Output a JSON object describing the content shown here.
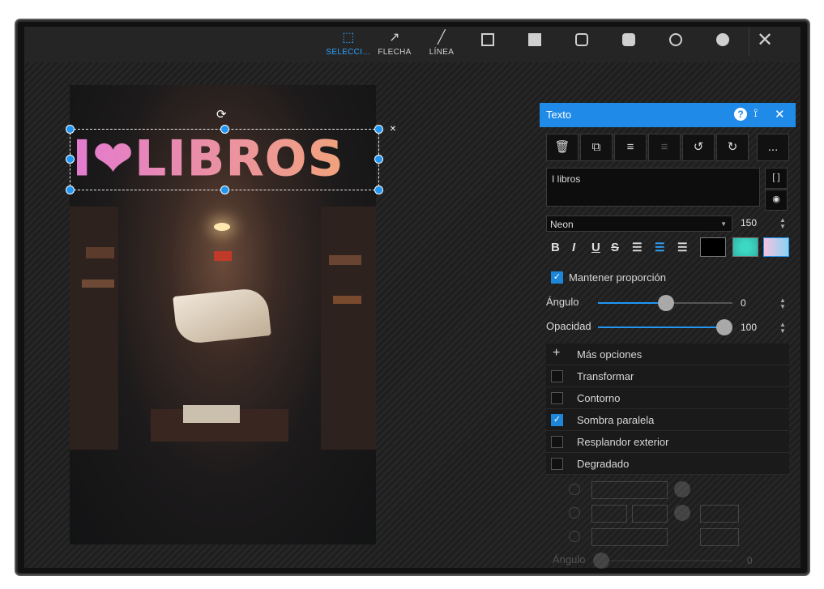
{
  "toolbar": {
    "select_label": "SELECCI…",
    "arrow_label": "FLECHA",
    "line_label": "LÍNEA"
  },
  "canvas": {
    "neon_text": "I❤LIBROS",
    "rotate_icon": "⟳",
    "close_icon": "✕"
  },
  "panel": {
    "title": "Texto",
    "help": "?",
    "pin": "📌",
    "close": "✕",
    "more_button": "...",
    "text_value": "I libros",
    "bracket_button": "[ ]",
    "font_family": "Neon",
    "font_size": "150",
    "keep_ratio_label": "Mantener proporción",
    "angle_label": "Ángulo",
    "angle_value": "0",
    "opacity_label": "Opacidad",
    "opacity_value": "100",
    "more_options_label": "Más opciones",
    "options": [
      {
        "label": "Transformar",
        "checked": false
      },
      {
        "label": "Contorno",
        "checked": false
      },
      {
        "label": "Sombra paralela",
        "checked": true
      },
      {
        "label": "Resplandor exterior",
        "checked": false
      },
      {
        "label": "Degradado",
        "checked": false
      }
    ],
    "disabled_angle_label": "Ángulo",
    "disabled_angle_value": "0"
  },
  "colors": {
    "accent": "#1f8ae8",
    "text_color": "#000000"
  }
}
